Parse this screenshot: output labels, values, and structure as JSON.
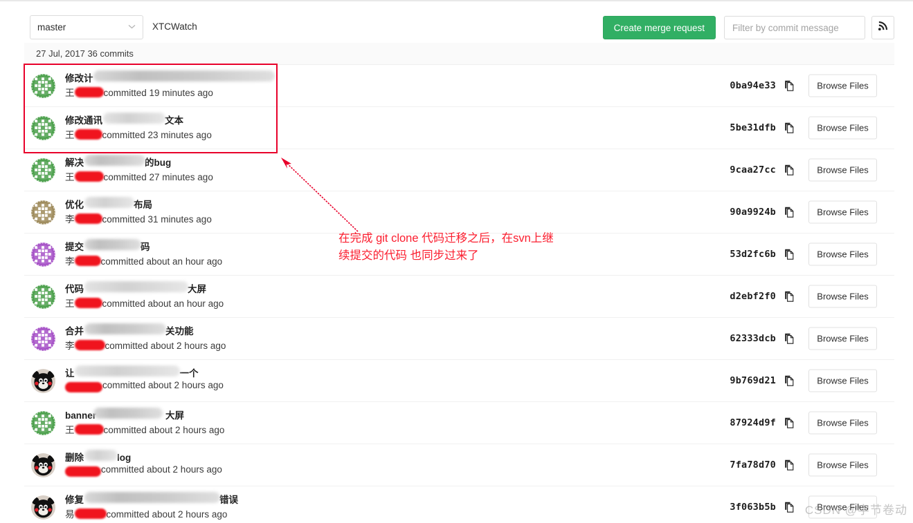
{
  "toolbar": {
    "branch": "master",
    "branch_caret_icon": "chevron-down-icon",
    "repo_name": "XTCWatch",
    "create_merge_request_label": "Create merge request",
    "filter_placeholder": "Filter by commit message",
    "filter_value": "",
    "rss_icon": "rss-icon"
  },
  "date_header": {
    "text": "27 Jul, 2017 36 commits"
  },
  "browse_label": "Browse Files",
  "copy_icon": "copy-icon",
  "commits": [
    {
      "title_prefix": "修改计",
      "title_suffix": "",
      "author_prefix": "王",
      "time": "committed 19 minutes ago",
      "hash": "0ba94e33",
      "avatar": "identicon-green",
      "redacted_title_w": 262,
      "redacted_author_w": 42
    },
    {
      "title_prefix": "修改通讯",
      "title_suffix": "文本",
      "author_prefix": "王",
      "time": "committed 23 minutes ago",
      "hash": "5be31dfb",
      "avatar": "identicon-green",
      "redacted_title_w": 90,
      "redacted_author_w": 40
    },
    {
      "title_prefix": "解决",
      "title_suffix": "的bug",
      "author_prefix": "王",
      "time": "committed 27 minutes ago",
      "hash": "9caa27cc",
      "avatar": "identicon-green",
      "redacted_title_w": 88,
      "redacted_author_w": 42
    },
    {
      "title_prefix": "优化",
      "title_suffix": "布局",
      "author_prefix": "李",
      "time": "committed 31 minutes ago",
      "hash": "90a9924b",
      "avatar": "identicon-tan",
      "redacted_title_w": 72,
      "redacted_author_w": 40
    },
    {
      "title_prefix": "提交",
      "title_suffix": "码",
      "author_prefix": "李",
      "time": "committed about an hour ago",
      "hash": "53d2fc6b",
      "avatar": "identicon-purple",
      "redacted_title_w": 82,
      "redacted_author_w": 38
    },
    {
      "title_prefix": "代码",
      "title_suffix": "大屏",
      "author_prefix": "王",
      "time": "committed about an hour ago",
      "hash": "d2ebf2f0",
      "avatar": "identicon-green",
      "redacted_title_w": 150,
      "redacted_author_w": 40
    },
    {
      "title_prefix": "合并",
      "title_suffix": "关功能",
      "author_prefix": "李",
      "time": "committed about 2 hours ago",
      "hash": "62333dcb",
      "avatar": "identicon-purple",
      "redacted_title_w": 118,
      "redacted_author_w": 44
    },
    {
      "title_prefix": "让",
      "title_suffix": "一个",
      "author_prefix": "",
      "time": "committed about 2 hours ago",
      "hash": "9b769d21",
      "avatar": "kumamon",
      "redacted_title_w": 152,
      "redacted_author_w": 54
    },
    {
      "title_prefix": "banner",
      "title_suffix": "大屏",
      "author_prefix": "王",
      "time": "committed about 2 hours ago",
      "hash": "87924d9f",
      "avatar": "identicon-green",
      "redacted_title_w": 100,
      "redacted_author_w": 42
    },
    {
      "title_prefix": "删除",
      "title_suffix": "log",
      "author_prefix": "",
      "time": "committed about 2 hours ago",
      "hash": "7fa78d70",
      "avatar": "kumamon",
      "redacted_title_w": 48,
      "redacted_author_w": 52
    },
    {
      "title_prefix": "修复",
      "title_suffix": "错误",
      "author_prefix": "易",
      "time": "committed about 2 hours ago",
      "hash": "3f063b5b",
      "avatar": "kumamon",
      "redacted_title_w": 196,
      "redacted_author_w": 46
    }
  ],
  "annotation": {
    "text_line1": "在完成 git clone 代码迁移之后，在svn上继",
    "text_line2": "续提交的代码 也同步过来了",
    "color": "#fb1d2e",
    "box_color": "#e8002a",
    "arrow_icon": "arrow-pointer"
  },
  "watermark": {
    "text": "CSDN @字节卷动"
  }
}
